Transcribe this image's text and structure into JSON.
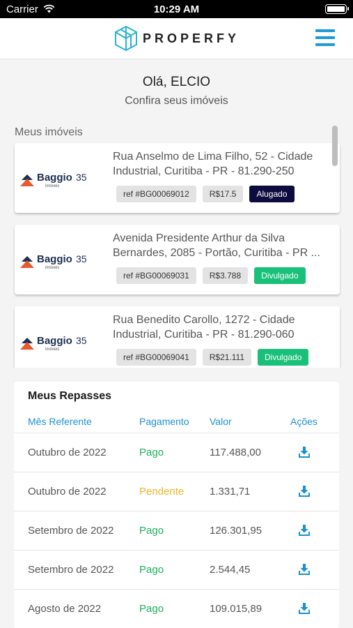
{
  "status_bar": {
    "carrier": "Carrier",
    "time": "10:29 AM"
  },
  "header": {
    "logo_text": "PROPERFY",
    "menu_icon": "hamburger-menu-icon"
  },
  "greeting": {
    "title": "Olá, ELCIO",
    "subtitle": "Confira seus imóveis"
  },
  "properties": {
    "label": "Meus imóveis",
    "items": [
      {
        "address": "Rua Anselmo de Lima Filho, 52 - Cidade Industrial, Curitiba - PR - 81.290-250",
        "ref": "ref #BG00069012",
        "price": "R$17.5",
        "status": "Alugado",
        "status_color": "#0d0b3f"
      },
      {
        "address": "Avenida Presidente Arthur da Silva Bernardes, 2085 - Portão, Curitiba - PR ...",
        "ref": "ref #BG00069031",
        "price": "R$3.788",
        "status": "Divulgado",
        "status_color": "#19c07a"
      },
      {
        "address": "Rua Benedito Carollo, 1272 - Cidade Industrial, Curitiba - PR - 81.290-060",
        "ref": "ref #BG00069041",
        "price": "R$21.111",
        "status": "Divulgado",
        "status_color": "#19c07a"
      }
    ],
    "brand": {
      "name": "Baggio",
      "badge": "35",
      "sub": "imóveis"
    }
  },
  "repasses": {
    "title": "Meus Repasses",
    "columns": [
      "Mês Referente",
      "Pagamento",
      "Valor",
      "Ações"
    ],
    "rows": [
      {
        "month": "Outubro de 2022",
        "status": "Pago",
        "status_color": "#1bb05a",
        "value": "117.488,00"
      },
      {
        "month": "Outubro de 2022",
        "status": "Pendente",
        "status_color": "#f3b322",
        "value": "1.331,71"
      },
      {
        "month": "Setembro de 2022",
        "status": "Pago",
        "status_color": "#1bb05a",
        "value": "126.301,95"
      },
      {
        "month": "Setembro de 2022",
        "status": "Pago",
        "status_color": "#1bb05a",
        "value": "2.544,45"
      },
      {
        "month": "Agosto de 2022",
        "status": "Pago",
        "status_color": "#1bb05a",
        "value": "109.015,89"
      }
    ],
    "action_icon": "download-icon"
  },
  "colors": {
    "accent": "#1b9bd8",
    "logo": "#2bb4cf"
  }
}
